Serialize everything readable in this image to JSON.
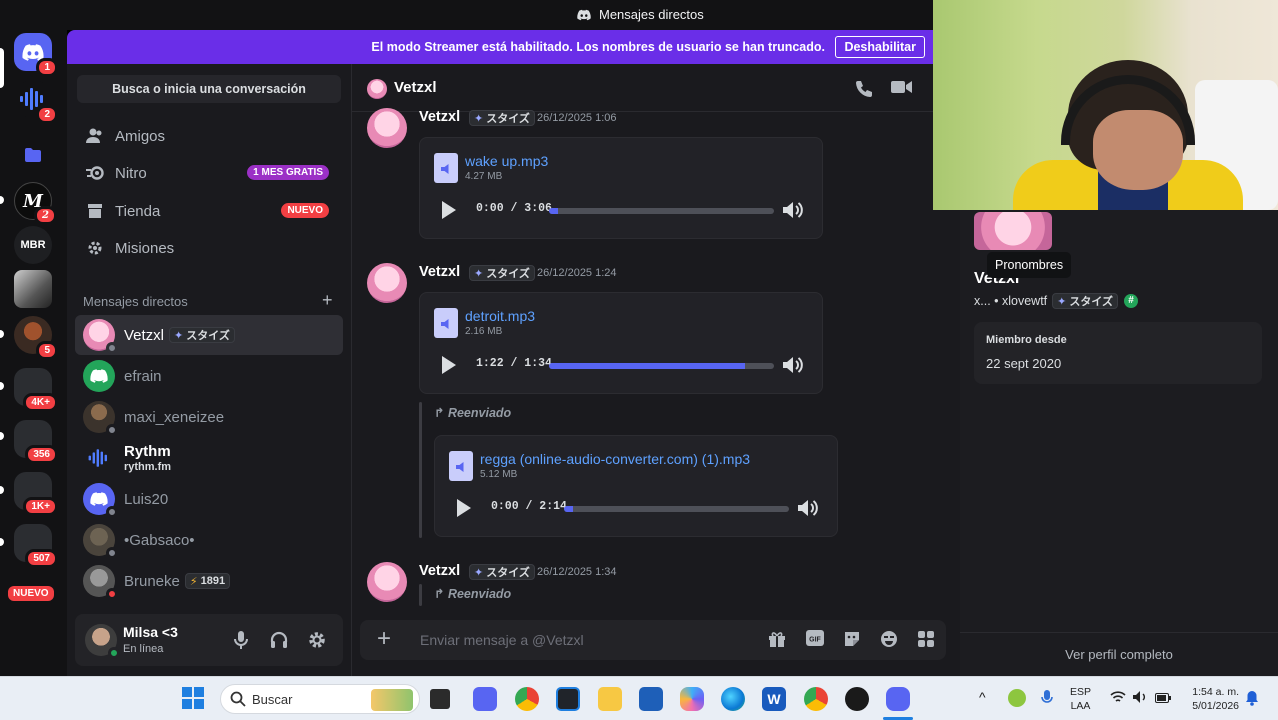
{
  "titlebar": {
    "title": "Mensajes directos"
  },
  "servers": [
    {
      "name": "discord-home",
      "badge": "1"
    },
    {
      "name": "rythm",
      "badge": "2"
    },
    {
      "name": "folder",
      "badge": ""
    },
    {
      "name": "server-m",
      "badge": "2"
    },
    {
      "name": "mbr",
      "label": "MBR",
      "badge": ""
    },
    {
      "name": "server-photo-1",
      "badge": ""
    },
    {
      "name": "server-photo-2",
      "badge": "5"
    },
    {
      "name": "server-folder-2",
      "badge": "4K+"
    },
    {
      "name": "server-folder-3",
      "badge": "356"
    },
    {
      "name": "server-folder-4",
      "badge": "1K+"
    },
    {
      "name": "server-folder-5",
      "badge": "507"
    }
  ],
  "servers_new_label": "NUEVO",
  "banner": {
    "text": "El modo Streamer está habilitado. Los nombres de usuario se han truncado.",
    "button": "Deshabilitar"
  },
  "sidebar": {
    "search": "Busca o inicia una conversación",
    "nav": [
      {
        "label": "Amigos",
        "badge": ""
      },
      {
        "label": "Nitro",
        "badge": "1 MES GRATIS"
      },
      {
        "label": "Tienda",
        "badge": "NUEVO"
      },
      {
        "label": "Misiones",
        "badge": ""
      }
    ],
    "dm_header": "Mensajes directos",
    "dms": [
      {
        "name": "Vetzxl",
        "tag": "スタイズ",
        "sub": ""
      },
      {
        "name": "efrain",
        "tag": "",
        "sub": ""
      },
      {
        "name": "maxi_xeneizee",
        "tag": "",
        "sub": ""
      },
      {
        "name": "Rythm",
        "tag": "",
        "sub": "rythm.fm"
      },
      {
        "name": "Luis20",
        "tag": "",
        "sub": ""
      },
      {
        "name": "•Gabsaco•",
        "tag": "",
        "sub": ""
      },
      {
        "name": "Bruneke",
        "tag": "1891",
        "sub": ""
      }
    ]
  },
  "user": {
    "name": "Milsa <3",
    "status": "En línea"
  },
  "chat": {
    "recipient": "Vetzxl",
    "messages": [
      {
        "author": "Vetzxl",
        "tag": "スタイズ",
        "time": "26/12/2025 1:06",
        "attachment": {
          "file": "wake up.mp3",
          "size": "4.27 MB",
          "time": "0:00 / 3:06",
          "progress": 0.04
        }
      },
      {
        "author": "Vetzxl",
        "tag": "スタイズ",
        "time": "26/12/2025 1:24",
        "attachment": {
          "file": "detroit.mp3",
          "size": "2.16 MB",
          "time": "1:22 / 1:34",
          "progress": 0.87
        },
        "forward_label": "Reenviado",
        "forwarded": {
          "file": "regga (online-audio-converter.com) (1).mp3",
          "size": "5.12 MB",
          "time": "0:00 / 2:14",
          "progress": 0.04
        }
      },
      {
        "author": "Vetzxl",
        "tag": "スタイズ",
        "time": "26/12/2025 1:34",
        "forward_label": "Reenviado"
      }
    ],
    "composer_placeholder": "Enviar mensaje a @Vetzxl"
  },
  "profile": {
    "name": "Vetzxl",
    "tooltip": "Pronombres",
    "username": "x... • xlovewtf",
    "tag": "スタイズ",
    "member_label": "Miembro desde",
    "member_since": "22 sept 2020",
    "full_profile": "Ver perfil completo"
  },
  "taskbar": {
    "search": "Buscar",
    "lang_top": "ESP",
    "lang_bottom": "LAA",
    "time": "1:54 a. m.",
    "date": "5/01/2026"
  },
  "colors": {
    "accent": "#5865f2",
    "banner": "#6a2ee8",
    "online": "#23a55a",
    "badge": "#f23f43"
  }
}
